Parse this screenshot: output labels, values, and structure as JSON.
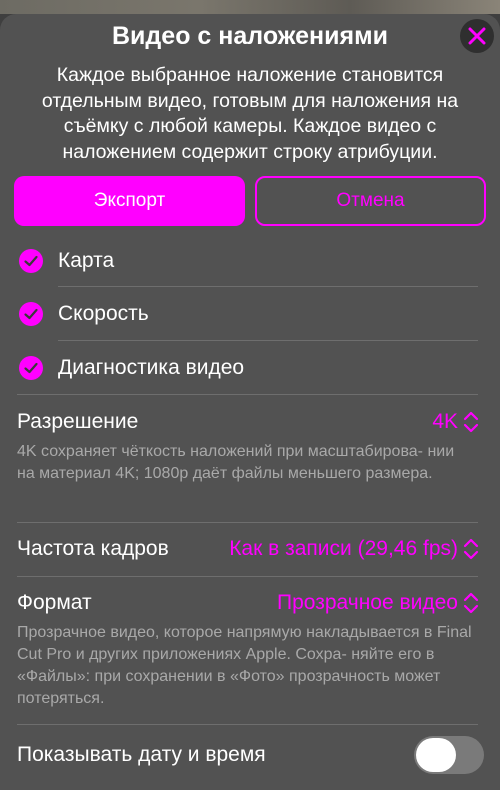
{
  "header": {
    "title": "Видео с наложениями",
    "description": "Каждое выбранное наложение становится отдельным видео, готовым для наложения на съёмку с любой камеры. Каждое видео с наложением содержит строку атрибуции."
  },
  "buttons": {
    "export_label": "Экспорт",
    "cancel_label": "Отмена"
  },
  "overlays": [
    {
      "label": "Карта",
      "checked": true
    },
    {
      "label": "Скорость",
      "checked": true
    },
    {
      "label": "Диагностика видео",
      "checked": true
    }
  ],
  "settings": {
    "resolution": {
      "label": "Разрешение",
      "value": "4K",
      "hint": "4K сохраняет чёткость наложений при масштабирова- нии на материал 4K; 1080p даёт файлы меньшего размера."
    },
    "framerate": {
      "label": "Частота кадров",
      "value": "Как в записи (29,46 fps)"
    },
    "format": {
      "label": "Формат",
      "value": "Прозрачное видео",
      "hint": "Прозрачное видео, которое напрямую накладывается в Final Cut Pro и других приложениях Apple. Сохра- няйте его в «Файлы»: при сохранении в «Фото» прозрачность может потеряться."
    },
    "show_datetime": {
      "label": "Показывать дату и время",
      "enabled": false
    }
  },
  "colors": {
    "accent": "#ff00ff",
    "sheet": "#525252",
    "hint_text": "#a9a9a9"
  },
  "icons": {
    "close": "close-icon",
    "check": "checkmark-circle-icon",
    "chevron": "chevron-up-down-icon"
  }
}
